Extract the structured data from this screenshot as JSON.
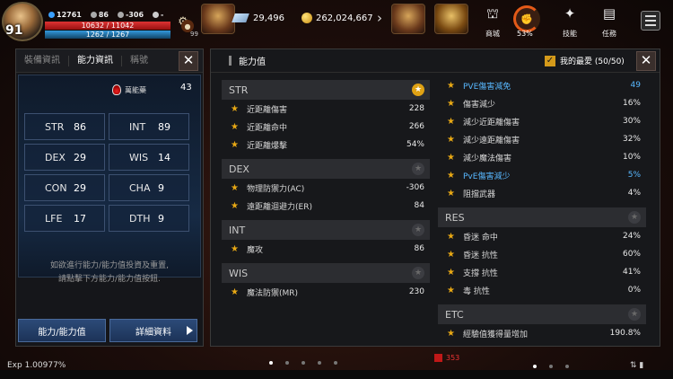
{
  "hud": {
    "level": "91",
    "stat_a": "12761",
    "stat_b": "86",
    "stat_c": "-306",
    "stat_d": "-",
    "hp": "10632 / 11042",
    "mp": "1262 / 1267",
    "bag_count": "99",
    "gem_amount": "29,496",
    "gold_amount": "262,024,667",
    "pct": "53%",
    "menu": [
      {
        "label": "商城",
        "icon": "shop-icon"
      },
      {
        "label": "技能",
        "icon": "skill-icon"
      },
      {
        "label": "任務",
        "icon": "quest-icon"
      }
    ]
  },
  "left": {
    "tabs": [
      "裝備資訊",
      "能力資訊",
      "稱號"
    ],
    "active_tab": 1,
    "potential_label": "萬能藥",
    "potential_value": "43",
    "stats": [
      {
        "k": "STR",
        "v": "86"
      },
      {
        "k": "INT",
        "v": "89"
      },
      {
        "k": "DEX",
        "v": "29"
      },
      {
        "k": "WIS",
        "v": "14"
      },
      {
        "k": "CON",
        "v": "29"
      },
      {
        "k": "CHA",
        "v": "9"
      },
      {
        "k": "LFE",
        "v": "17"
      },
      {
        "k": "DTH",
        "v": "9"
      }
    ],
    "hint_line1": "如欲進行能力/能力值投資及重置,",
    "hint_line2": "請點擊下方能力/能力值按鈕.",
    "btn_ability": "能力/能力值",
    "btn_detail": "詳細資料"
  },
  "right": {
    "title": "能力值",
    "favorites": "我的最愛 (50/50)",
    "left_sections": [
      {
        "name": "STR",
        "fav": true,
        "rows": [
          {
            "name": "近距離傷害",
            "val": "228"
          },
          {
            "name": "近距離命中",
            "val": "266"
          },
          {
            "name": "近距離爆擊",
            "val": "54%"
          }
        ]
      },
      {
        "name": "DEX",
        "fav": false,
        "rows": [
          {
            "name": "物理防禦力(AC)",
            "val": "-306"
          },
          {
            "name": "遠距離迴避力(ER)",
            "val": "84"
          }
        ]
      },
      {
        "name": "INT",
        "fav": false,
        "rows": [
          {
            "name": "魔攻",
            "val": "86"
          }
        ]
      },
      {
        "name": "WIS",
        "fav": false,
        "rows": [
          {
            "name": "魔法防禦(MR)",
            "val": "230"
          }
        ]
      }
    ],
    "right_top_rows": [
      {
        "name": "PVE傷害減免",
        "val": "49",
        "blue": true
      },
      {
        "name": "傷害減少",
        "val": "16%",
        "blue": false
      },
      {
        "name": "減少近距離傷害",
        "val": "30%",
        "blue": false
      },
      {
        "name": "減少遠距離傷害",
        "val": "32%",
        "blue": false
      },
      {
        "name": "減少魔法傷害",
        "val": "10%",
        "blue": false
      },
      {
        "name": "PvE傷害減少",
        "val": "5%",
        "blue": true
      },
      {
        "name": "阻擋武器",
        "val": "4%",
        "blue": false
      }
    ],
    "right_sections": [
      {
        "name": "RES",
        "fav": false,
        "rows": [
          {
            "name": "昏迷 命中",
            "val": "24%"
          },
          {
            "name": "昏迷 抗性",
            "val": "60%"
          },
          {
            "name": "支撐 抗性",
            "val": "41%"
          },
          {
            "name": "毒 抗性",
            "val": "0%"
          }
        ]
      },
      {
        "name": "ETC",
        "fav": false,
        "rows": [
          {
            "name": "經驗值獲得量增加",
            "val": "190.8%"
          }
        ]
      }
    ]
  },
  "bottom": {
    "exp": "Exp 1.00977%",
    "badge": "353"
  }
}
